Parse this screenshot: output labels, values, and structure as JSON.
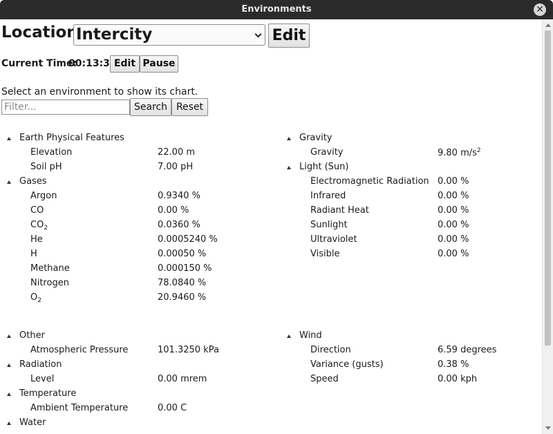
{
  "window": {
    "title": "Environments"
  },
  "location": {
    "label": "Location:",
    "selected": "Intercity",
    "edit_label": "Edit"
  },
  "time": {
    "label": "Current Time:",
    "value": "00:13:30",
    "edit_label": "Edit",
    "pause_label": "Pause"
  },
  "hint": "Select an environment to show its chart.",
  "filter": {
    "placeholder": "Filter...",
    "value": "",
    "search_label": "Search",
    "reset_label": "Reset"
  },
  "left_groups": [
    {
      "name": "Earth Physical Features",
      "items": [
        {
          "name": "Elevation",
          "value": "22.00 m"
        },
        {
          "name": "Soil pH",
          "value": "7.00 pH"
        }
      ]
    },
    {
      "name": "Gases",
      "items": [
        {
          "name": "Argon",
          "value": "0.9340 %"
        },
        {
          "name": "CO",
          "value": "0.00 %"
        },
        {
          "name": "CO",
          "sub": "2",
          "value": "0.0360 %"
        },
        {
          "name": "He",
          "value": "0.0005240 %"
        },
        {
          "name": "H",
          "value": "0.00050 %"
        },
        {
          "name": "Methane",
          "value": "0.000150 %"
        },
        {
          "name": "Nitrogen",
          "value": "78.0840 %"
        },
        {
          "name": "O",
          "sub": "2",
          "value": "20.9460 %"
        }
      ]
    },
    {
      "name": "Other",
      "items": [
        {
          "name": "Atmospheric Pressure",
          "value": "101.3250 kPa"
        }
      ]
    },
    {
      "name": "Radiation",
      "items": [
        {
          "name": "Level",
          "value": "0.00 mrem"
        }
      ]
    },
    {
      "name": "Temperature",
      "items": [
        {
          "name": "Ambient Temperature",
          "value": "0.00 C"
        }
      ]
    },
    {
      "name": "Water",
      "items": []
    }
  ],
  "right_groups": [
    {
      "name": "Gravity",
      "items": [
        {
          "name": "Gravity",
          "value": "9.80 m/s",
          "sup": "2"
        }
      ]
    },
    {
      "name": "Light (Sun)",
      "items": [
        {
          "name": "Electromagnetic Radiation",
          "value": "0.00 %"
        },
        {
          "name": "Infrared",
          "value": "0.00 %"
        },
        {
          "name": "Radiant Heat",
          "value": "0.00 %"
        },
        {
          "name": "Sunlight",
          "value": "0.00 %"
        },
        {
          "name": "Ultraviolet",
          "value": "0.00 %"
        },
        {
          "name": "Visible",
          "value": "0.00 %"
        }
      ]
    },
    {
      "name": "Wind",
      "items": [
        {
          "name": "Direction",
          "value": "6.59 degrees"
        },
        {
          "name": "Variance (gusts)",
          "value": "0.38 %"
        },
        {
          "name": "Speed",
          "value": "0.00 kph"
        }
      ]
    }
  ]
}
